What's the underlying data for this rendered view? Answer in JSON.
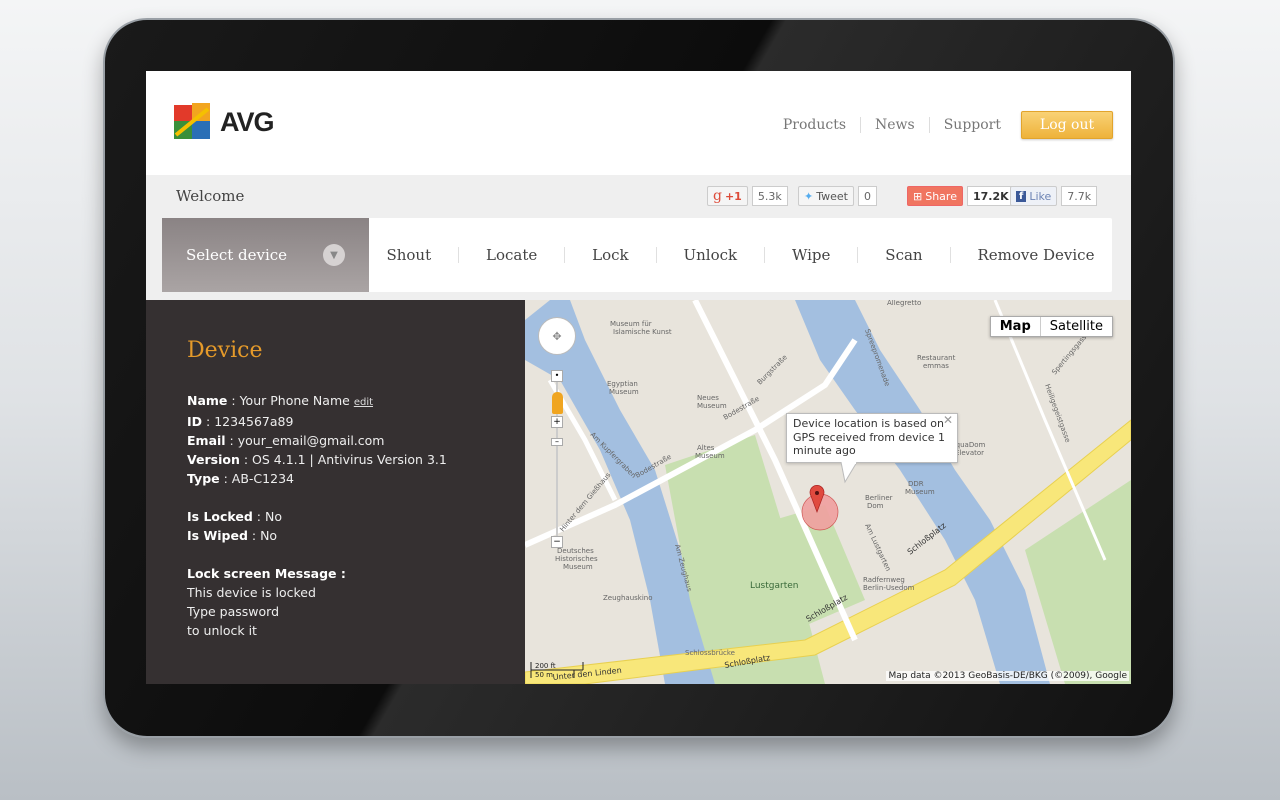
{
  "header": {
    "logo_text": "AVG",
    "nav": [
      "Products",
      "News",
      "Support"
    ],
    "logout": "Log out"
  },
  "welcome": "Welcome",
  "social": {
    "gplus_label": "+1",
    "gplus_count": "5.3k",
    "tweet_label": "Tweet",
    "tweet_count": "0",
    "share_label": "Share",
    "share_count": "17.2K",
    "like_label": "Like",
    "like_count": "7.7k",
    "colors": {
      "share": "#f07560",
      "twitter": "#55acee",
      "facebook": "#3b5998",
      "gplus": "#dd4b39"
    }
  },
  "toolbar": {
    "select_device": "Select device",
    "actions": [
      "Shout",
      "Locate",
      "Lock",
      "Unlock",
      "Wipe",
      "Scan",
      "Remove Device"
    ]
  },
  "device": {
    "title": "Device",
    "name_label": "Name",
    "name": "Your Phone Name",
    "edit": "edit",
    "id_label": "ID",
    "id": "1234567a89",
    "email_label": "Email",
    "email": "your_email@gmail.com",
    "version_label": "Version",
    "version": "OS 4.1.1 | Antivirus Version 3.1",
    "type_label": "Type",
    "type": "AB-C1234",
    "locked_label": "Is Locked",
    "locked": "No",
    "wiped_label": "Is Wiped",
    "wiped": "No",
    "lock_msg_label": "Lock screen Message :",
    "lock_msg": [
      "This device is locked",
      "Type password",
      "to unlock it"
    ]
  },
  "map": {
    "type_map": "Map",
    "type_satellite": "Satellite",
    "info": "Device location is based on GPS received from device 1 minute ago",
    "attribution": "Map data ©2013 GeoBasis-DE/BKG (©2009), Google",
    "scale_ft": "200 ft",
    "scale_m": "50 m",
    "labels": [
      "Museum für Islamische Kunst",
      "Egyptian Museum",
      "Neues Museum",
      "Altes Museum",
      "Burgstraße",
      "Bodestraße",
      "Am Kupfergraben",
      "Hinter dem Gießhaus",
      "Am Zeughaus",
      "Deutsches Historisches Museum",
      "Zeughauskino",
      "Lustgarten",
      "Am Lustgarten",
      "Berliner Dom",
      "DDR Museum",
      "AquaDom Elevator",
      "Restaurant emmas",
      "Spreepromenade",
      "Heiligegeistgasse",
      "Spertingsgasse",
      "Allegretto",
      "Schloßplatz",
      "Schlossbrücke",
      "Unter den Linden",
      "Radfernweg Berlin-Usedom"
    ],
    "colors": {
      "water": "#a3bfe0",
      "park": "#c8dfb0",
      "road": "#f8e77a",
      "marker": "#e04a3f"
    }
  }
}
